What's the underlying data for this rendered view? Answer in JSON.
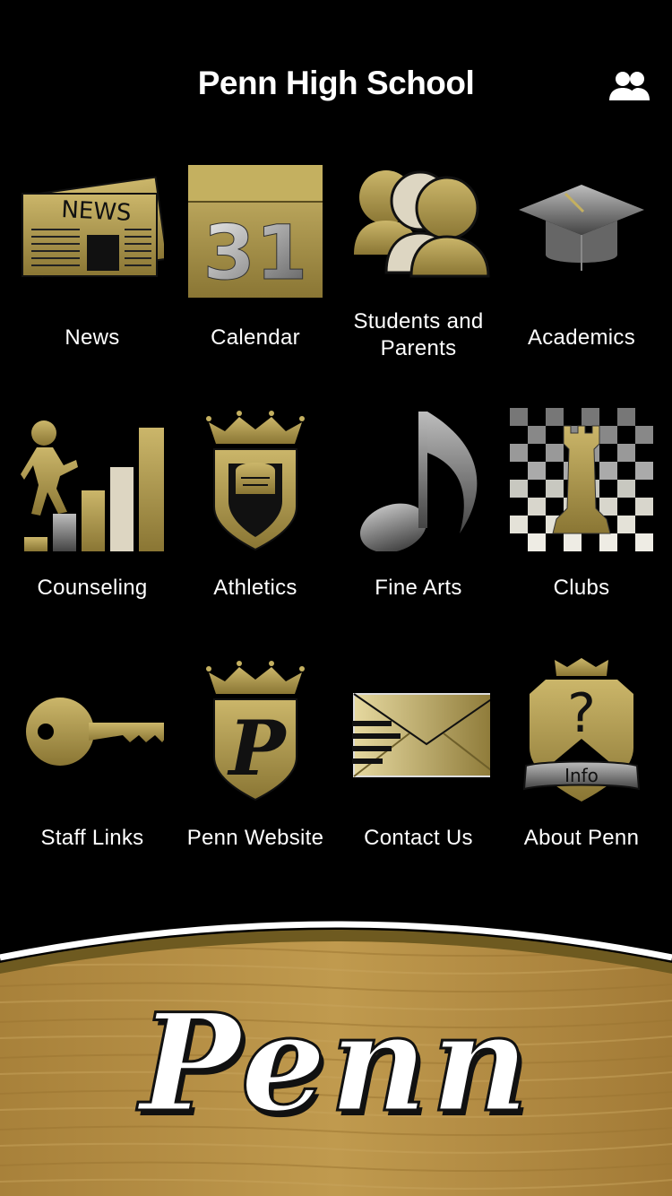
{
  "header": {
    "title": "Penn High School",
    "profile_icon": "people-icon"
  },
  "colors": {
    "background": "#000000",
    "gold": "#b8a45a",
    "gold_dark": "#6e5f2a",
    "wood": "#b08a3e",
    "text": "#ffffff"
  },
  "tiles": [
    {
      "label": "News",
      "icon": "newspaper-icon"
    },
    {
      "label": "Calendar",
      "icon": "calendar-icon",
      "icon_text": "31"
    },
    {
      "label": "Students and Parents",
      "icon": "group-icon"
    },
    {
      "label": "Academics",
      "icon": "graduation-cap-icon"
    },
    {
      "label": "Counseling",
      "icon": "stairs-climber-icon"
    },
    {
      "label": "Athletics",
      "icon": "knight-shield-icon"
    },
    {
      "label": "Fine Arts",
      "icon": "music-note-icon"
    },
    {
      "label": "Clubs",
      "icon": "chess-rook-icon"
    },
    {
      "label": "Staff Links",
      "icon": "key-icon"
    },
    {
      "label": "Penn Website",
      "icon": "p-shield-icon",
      "icon_text": "P"
    },
    {
      "label": "Contact Us",
      "icon": "envelope-icon"
    },
    {
      "label": "About Penn",
      "icon": "info-shield-icon",
      "icon_text": "Info"
    }
  ],
  "footer": {
    "brand_text": "Penn",
    "news_icon_text": "NEWS",
    "about_icon_mark": "?"
  }
}
